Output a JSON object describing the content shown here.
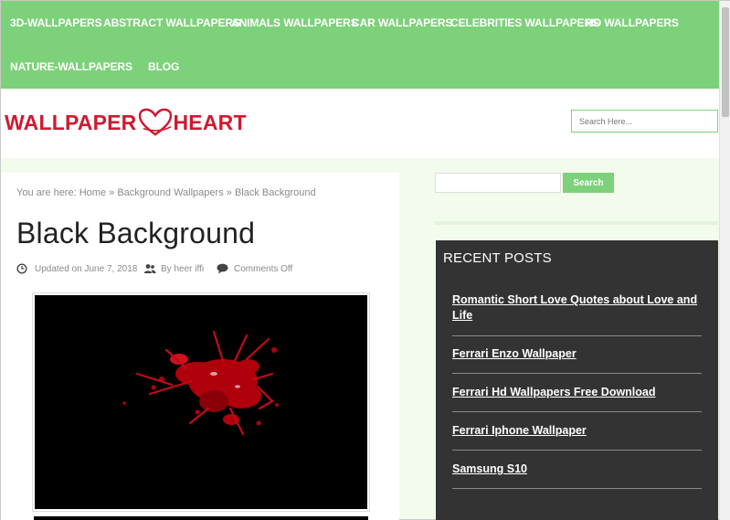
{
  "nav": {
    "items": [
      {
        "label": "3D-WALLPAPERS"
      },
      {
        "label": "ABSTRACT WALLPAPERS"
      },
      {
        "label": "ANIMALS WALLPAPERS"
      },
      {
        "label": "CAR WALLPAPERS"
      },
      {
        "label": "CELEBRITIES WALLPAPERS"
      },
      {
        "label": "HD WALLPAPERS"
      },
      {
        "label": "NATURE-WALLPAPERS"
      },
      {
        "label": "BLOG"
      }
    ]
  },
  "header": {
    "logo_left": "WALLPAPER",
    "logo_right": "HEART",
    "search_placeholder": "Search Here..."
  },
  "breadcrumb": {
    "prefix": "You are here:",
    "home": "Home",
    "sep": "»",
    "category": "Background Wallpapers",
    "current": "Black Background"
  },
  "post": {
    "title": "Black Background",
    "updated": "Updated on June 7, 2018",
    "author": "By heer iffi",
    "comments": "Comments Off"
  },
  "sidebar": {
    "search_button": "Search",
    "recent_title": "RECENT POSTS",
    "recent_posts": [
      "Romantic Short Love Quotes about Love and Life",
      "Ferrari Enzo Wallpaper",
      "Ferrari Hd Wallpapers Free Download",
      "Ferrari Iphone Wallpaper",
      "Samsung S10"
    ]
  },
  "colors": {
    "nav_bg": "#7dd17a",
    "logo_red": "#d0192f",
    "sidebar_dark": "#333333"
  }
}
